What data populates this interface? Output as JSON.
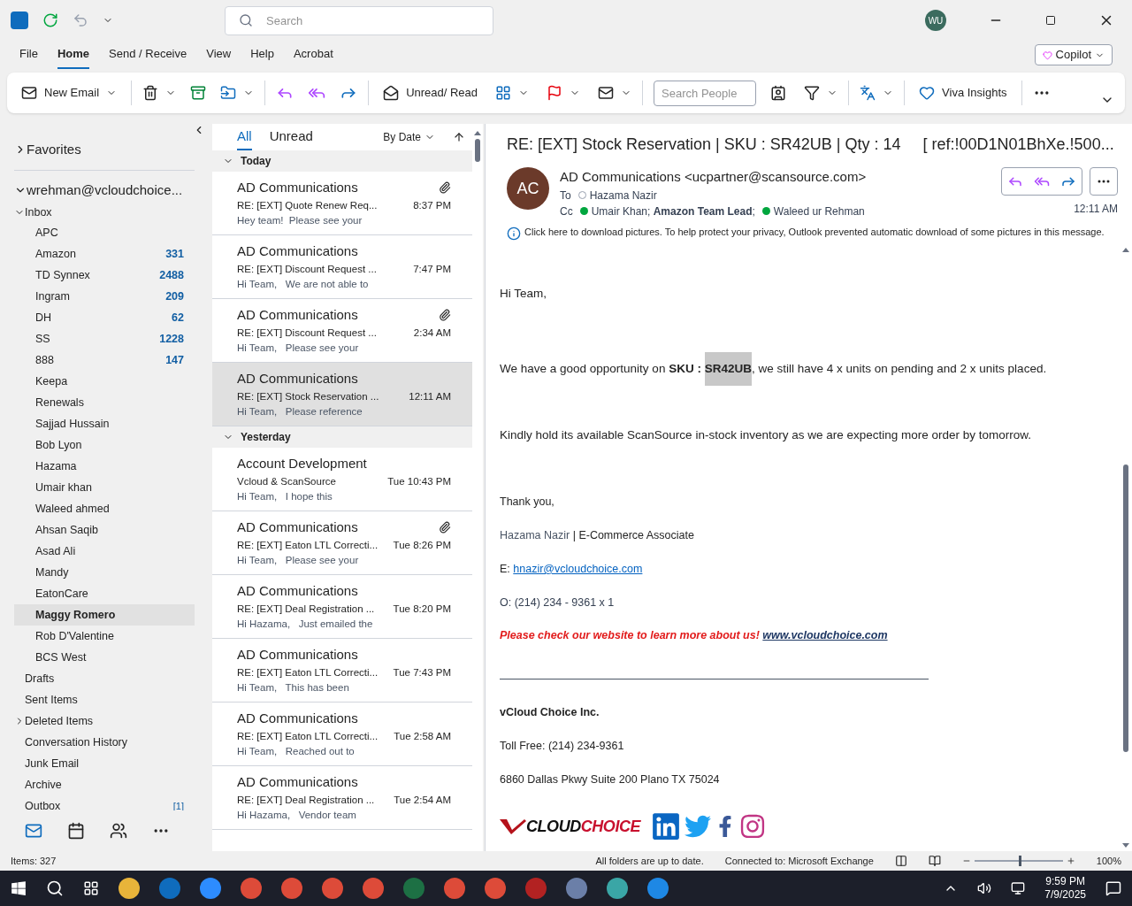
{
  "title_bar": {
    "search_placeholder": "Search",
    "avatar": "WU"
  },
  "menu_tabs": [
    {
      "label": "File",
      "selected": false
    },
    {
      "label": "Home",
      "selected": true
    },
    {
      "label": "Send / Receive",
      "selected": false
    },
    {
      "label": "View",
      "selected": false
    },
    {
      "label": "Help",
      "selected": false
    },
    {
      "label": "Acrobat",
      "selected": false
    }
  ],
  "copilot": "Copilot",
  "ribbon": {
    "new_email": "New Email",
    "unread_read": "Unread/ Read",
    "search_people_placeholder": "Search People",
    "viva": "Viva Insights"
  },
  "folders": {
    "favorites": "Favorites",
    "account": "wrehman@vcloudchoice...",
    "inbox": {
      "name": "Inbox",
      "expanded": true,
      "children": [
        {
          "name": "APC",
          "selected": false
        },
        {
          "name": "Amazon",
          "count": "331",
          "selected": false
        },
        {
          "name": "TD Synnex",
          "count": "2488",
          "selected": false
        },
        {
          "name": "Ingram",
          "count": "209",
          "selected": false
        },
        {
          "name": "DH",
          "count": "62",
          "selected": false
        },
        {
          "name": "SS",
          "count": "1228",
          "selected": false
        },
        {
          "name": "888",
          "count": "147",
          "selected": false
        },
        {
          "name": "Keepa",
          "selected": false
        },
        {
          "name": "Renewals",
          "selected": false
        },
        {
          "name": "Sajjad Hussain",
          "selected": false
        },
        {
          "name": "Bob Lyon",
          "selected": false
        },
        {
          "name": "Hazama",
          "selected": false
        },
        {
          "name": "Umair khan",
          "selected": false
        },
        {
          "name": "Waleed ahmed",
          "selected": false
        },
        {
          "name": "Ahsan Saqib",
          "selected": false
        },
        {
          "name": "Asad Ali",
          "selected": false
        },
        {
          "name": "Mandy",
          "selected": false
        },
        {
          "name": "EatonCare",
          "selected": false
        },
        {
          "name": "Maggy Romero",
          "selected": true
        },
        {
          "name": "Rob D'Valentine",
          "selected": false
        },
        {
          "name": "BCS West",
          "selected": false
        }
      ]
    },
    "others": [
      {
        "name": "Drafts",
        "expandable": false
      },
      {
        "name": "Sent Items",
        "expandable": false
      },
      {
        "name": "Deleted Items",
        "expandable": true
      },
      {
        "name": "Conversation History",
        "expandable": false
      },
      {
        "name": "Junk Email",
        "expandable": false
      },
      {
        "name": "Archive",
        "expandable": false
      },
      {
        "name": "Outbox",
        "count": "[1]",
        "expandable": false
      }
    ]
  },
  "message_list": {
    "filters": [
      {
        "label": "All",
        "selected": true
      },
      {
        "label": "Unread",
        "selected": false
      }
    ],
    "sort": "By Date",
    "groups": [
      {
        "label": "Today",
        "expanded": true,
        "messages": [
          {
            "sender": "AD Communications",
            "subject": "RE: [EXT] Quote Renew Req...",
            "time": "8:37 PM",
            "preview": "Hey team!  Please see your",
            "attachment": true,
            "selected": false
          },
          {
            "sender": "AD Communications",
            "subject": "RE: [EXT] Discount Request ...",
            "time": "7:47 PM",
            "preview": "Hi Team,   We are not able to",
            "attachment": false,
            "selected": false
          },
          {
            "sender": "AD Communications",
            "subject": "RE: [EXT] Discount Request ...",
            "time": "2:34 AM",
            "preview": "Hi Team,   Please see your",
            "attachment": true,
            "selected": false
          },
          {
            "sender": "AD Communications",
            "subject": "RE: [EXT] Stock Reservation ...",
            "time": "12:11 AM",
            "preview": "Hi Team,   Please reference",
            "attachment": false,
            "selected": true
          }
        ]
      },
      {
        "label": "Yesterday",
        "expanded": true,
        "messages": [
          {
            "sender": "Account Development",
            "subject": "Vcloud & ScanSource",
            "time": "Tue 10:43 PM",
            "preview": "Hi Team,   I hope this",
            "attachment": false,
            "selected": false
          },
          {
            "sender": "AD Communications",
            "subject": "RE: [EXT] Eaton LTL Correcti...",
            "time": "Tue 8:26 PM",
            "preview": "Hi Team,   Please see your",
            "attachment": true,
            "selected": false
          },
          {
            "sender": "AD Communications",
            "subject": "RE: [EXT] Deal Registration ...",
            "time": "Tue 8:20 PM",
            "preview": "Hi Hazama,   Just emailed the",
            "attachment": false,
            "selected": false
          },
          {
            "sender": "AD Communications",
            "subject": "RE: [EXT] Eaton LTL Correcti...",
            "time": "Tue 7:43 PM",
            "preview": "Hi Team,   This has been",
            "attachment": false,
            "selected": false
          },
          {
            "sender": "AD Communications",
            "subject": "RE: [EXT] Eaton LTL Correcti...",
            "time": "Tue 2:58 AM",
            "preview": "Hi Team,   Reached out to",
            "attachment": false,
            "selected": false
          },
          {
            "sender": "AD Communications",
            "subject": "RE: [EXT] Deal Registration ...",
            "time": "Tue 2:54 AM",
            "preview": "Hi Hazama,   Vendor team",
            "attachment": false,
            "selected": false
          }
        ]
      }
    ]
  },
  "reading": {
    "subject": "RE: [EXT] Stock Reservation | SKU : SR42UB | Qty : 14     [ ref:!00D1N01BhXe.!500...",
    "avatar": "AC",
    "from": "AD Communications <ucpartner@scansource.com>",
    "to_label": "To",
    "to": "Hazama Nazir",
    "cc_label": "Cc",
    "cc": "Umair Khan; **Amazon Team Lead**;",
    "cc2": "Waleed ur Rehman",
    "time": "12:11 AM",
    "info": "Click here to download pictures. To help protect your privacy, Outlook prevented automatic download of some pictures in this message.",
    "body": [
      {
        "kind": "text",
        "text": "Hi Team,"
      },
      {
        "kind": "highlight",
        "before": "We have a good opportunity on **SKU :** ",
        "mark": "SR42UB",
        "after": ", we still have 4 x units on pending and 2 x units placed."
      },
      {
        "kind": "text",
        "text": "Kindly hold its available ScanSource in-stock inventory as we are expecting more order by tomorrow."
      },
      {
        "kind": "line",
        "text": "Thank you,"
      },
      {
        "kind": "signature",
        "name": "Hazama Nazir",
        "role": " | E-Commerce Associate"
      },
      {
        "kind": "email",
        "label": "E: ",
        "link": "hnazir@vcloudchoice.com"
      },
      {
        "kind": "phone",
        "text": "O: (214) 234 - 9361 x 1"
      },
      {
        "kind": "promo",
        "text": "Please check our website to learn more about us!",
        "link": "www.vcloudchoice.com"
      },
      {
        "kind": "rule"
      },
      {
        "kind": "bold",
        "text": "vCloud Choice Inc."
      },
      {
        "kind": "line",
        "text": "Toll Free: (214) 234-9361"
      },
      {
        "kind": "line",
        "text": "6860 Dallas Pkwy Suite 200 Plano TX 75024"
      },
      {
        "kind": "logos",
        "logo_a": "CLOUD",
        "logo_b": "CHOICE"
      }
    ]
  },
  "status_bar": {
    "items": "Items: 327",
    "sync": "All folders are up to date.",
    "connection": "Connected to: Microsoft Exchange",
    "zoom": "100%",
    "level": 0.5
  },
  "taskbar": {
    "time": "9:59 PM",
    "date": "7/9/2025"
  }
}
